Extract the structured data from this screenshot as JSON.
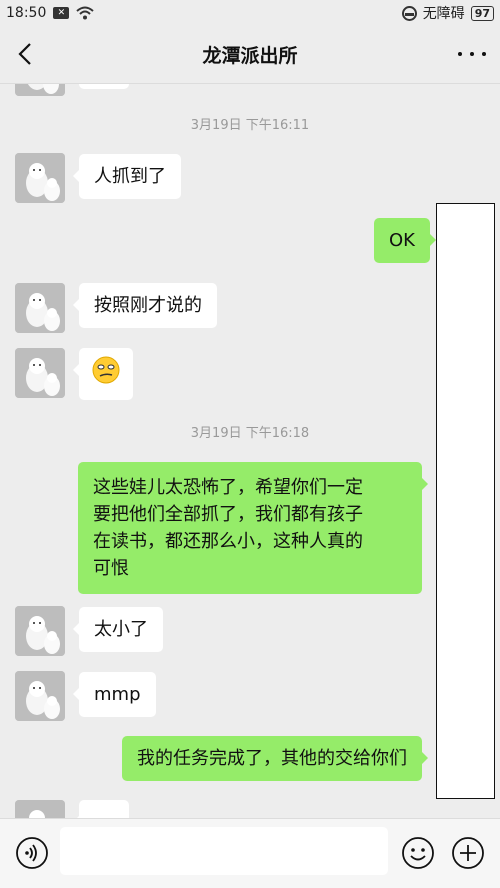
{
  "status_bar": {
    "time": "18:50",
    "notification_badge": "✕",
    "accessibility_label": "无障碍",
    "battery": "97"
  },
  "header": {
    "title": "龙潭派出所",
    "back_icon": "chevron-left-icon",
    "more_icon": "more-dots-icon"
  },
  "chat": {
    "timestamps": [
      "3月19日 下午16:11",
      "3月19日 下午16:18"
    ],
    "messages": [
      {
        "from": "them",
        "text": "人抓到了"
      },
      {
        "from": "me",
        "text": "OK"
      },
      {
        "from": "them",
        "text": "按照刚才说的"
      },
      {
        "from": "them",
        "text": "🧐",
        "kind": "emoji"
      },
      {
        "from": "me",
        "lines": [
          "这些娃儿太恐怖了，希望你们一定",
          "要把他们全部抓了，我们都有孩子",
          "在读书，都还那么小，这种人真的",
          "可恨"
        ]
      },
      {
        "from": "them",
        "text": "太小了"
      },
      {
        "from": "them",
        "text": "mmp"
      },
      {
        "from": "me",
        "text": "我的任务完成了，其他的交给你们"
      }
    ]
  },
  "input_bar": {
    "voice_icon": "voice-icon",
    "emoji_icon": "smiley-icon",
    "plus_icon": "plus-icon"
  },
  "colors": {
    "background": "#ededed",
    "bubble_out": "#95ec69",
    "bubble_in": "#ffffff"
  }
}
